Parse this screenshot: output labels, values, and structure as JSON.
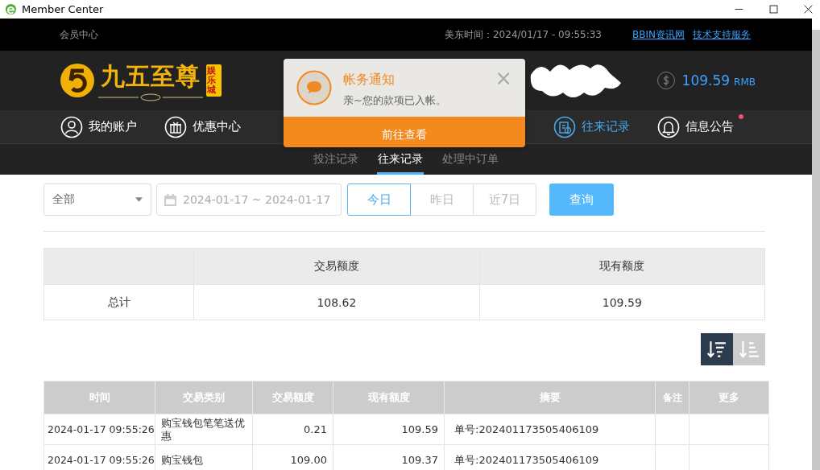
{
  "window": {
    "title": "Member Center"
  },
  "topbar": {
    "label": "会员中心",
    "time": "美东时间：2024/01/17 - 09:55:33",
    "links": [
      "BBIN资讯网",
      "技术支持服务"
    ]
  },
  "header": {
    "logo_text": "九五至尊",
    "logo_badge": "娱乐城",
    "balance": "109.59",
    "currency": "RMB"
  },
  "nav": [
    {
      "label": "我的账户",
      "kind": "user",
      "selected": false,
      "dot": false
    },
    {
      "label": "优惠中心",
      "kind": "gift",
      "selected": false,
      "dot": false
    },
    {
      "label": "往来记录",
      "kind": "record",
      "selected": true,
      "dot": false
    },
    {
      "label": "信息公告",
      "kind": "bell",
      "selected": false,
      "dot": true
    }
  ],
  "subtabs": [
    {
      "label": "投注记录",
      "selected": false
    },
    {
      "label": "往来记录",
      "selected": true
    },
    {
      "label": "处理中订单",
      "selected": false
    }
  ],
  "notice": {
    "title": "帐务通知",
    "message": "亲~您的款项已入帐。",
    "close": "×",
    "action": "前往查看"
  },
  "filters": {
    "type": "全部",
    "date_range": "2024-01-17 ~ 2024-01-17",
    "ranges": [
      {
        "label": "今日",
        "selected": true
      },
      {
        "label": "昨日",
        "selected": false
      },
      {
        "label": "近7日",
        "selected": false
      }
    ],
    "search": "查询"
  },
  "summary": {
    "columns": [
      "交易额度",
      "现有额度"
    ],
    "row_label": "总计",
    "values": [
      "108.62",
      "109.59"
    ]
  },
  "sort": [
    {
      "selected": true
    },
    {
      "selected": false
    }
  ],
  "table": {
    "columns": [
      "时间",
      "交易类别",
      "交易额度",
      "现有额度",
      "摘要",
      "备注",
      "更多"
    ],
    "rows": [
      [
        "2024-01-17 09:55:26",
        "购宝钱包笔笔送优惠",
        "0.21",
        "109.59",
        "单号:202401173505406109",
        "",
        ""
      ],
      [
        "2024-01-17 09:55:26",
        "购宝钱包",
        "109.00",
        "109.37",
        "单号:202401173505406109",
        "",
        ""
      ]
    ]
  }
}
